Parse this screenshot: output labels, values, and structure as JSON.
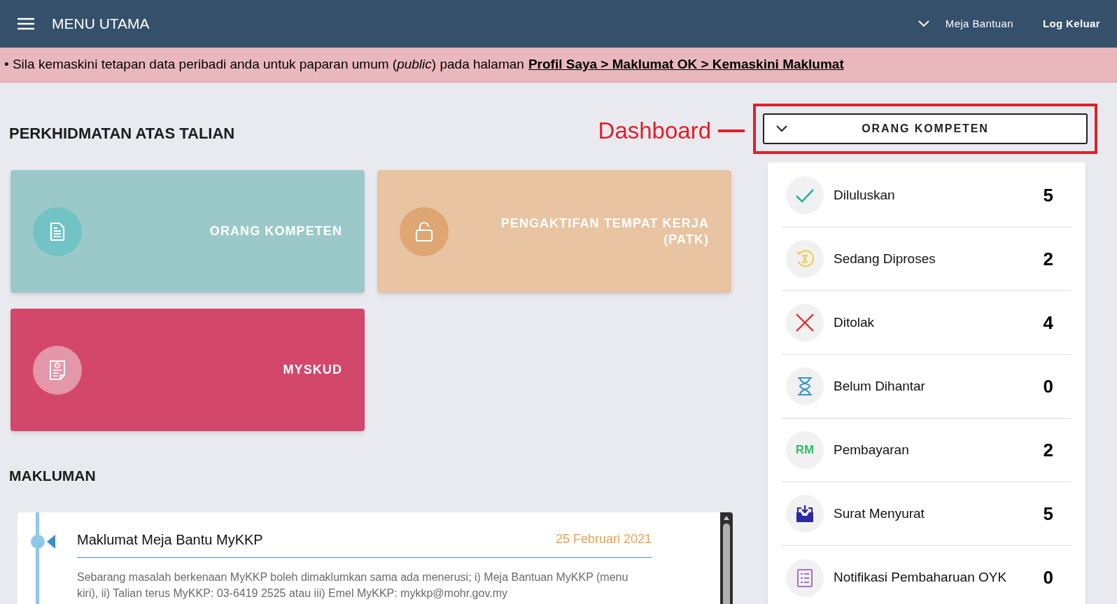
{
  "header": {
    "menu_title": "MENU UTAMA",
    "help_label": "Meja Bantuan",
    "logout_label": "Log Keluar"
  },
  "notice": {
    "text": "• Sila kemaskini tetapan data peribadi anda untuk paparan umum (*public*) pada halaman",
    "link": "Profil Saya > Maklumat OK > Kemaskini Maklumat"
  },
  "services": {
    "title": "PERKHIDMATAN ATAS TALIAN",
    "cards": [
      {
        "kind": "document",
        "label": "ORANG KOMPETEN",
        "color": "#9bc9c9"
      },
      {
        "kind": "lock",
        "label": "PENGAKTIFAN TEMPAT KERJA (PATK)",
        "color": "#e8c4a2"
      },
      {
        "kind": "report",
        "label": "MYSKUD",
        "color": "#d3476a"
      }
    ]
  },
  "dashboard": {
    "annotation": "Dashboard",
    "selected": "ORANG KOMPETEN"
  },
  "stats": [
    {
      "kind": "approved",
      "label": "Diluluskan",
      "count": "5"
    },
    {
      "kind": "processing",
      "label": "Sedang Diproses",
      "count": "2"
    },
    {
      "kind": "rejected",
      "label": "Ditolak",
      "count": "4"
    },
    {
      "kind": "pending",
      "label": "Belum Dihantar",
      "count": "0"
    },
    {
      "kind": "payment",
      "label": "Pembayaran",
      "count": "2",
      "icon_text": "RM"
    },
    {
      "kind": "mail",
      "label": "Surat Menyurat",
      "count": "5"
    },
    {
      "kind": "notification",
      "label": "Notifikasi Pembaharuan OYK",
      "count": "0"
    }
  ],
  "announcements": {
    "title": "MAKLUMAN",
    "items": [
      {
        "title": "Maklumat Meja Bantu MyKKP",
        "date": "25 Februari 2021",
        "body": "Sebarang masalah berkenaan MyKKP boleh dimaklumkan sama ada menerusi; i) Meja Bantuan MyKKP (menu kiri), ii) Talian terus MyKKP: 03-6419 2525 atau iii) Emel MyKKP: mykkp@mohr.gov.my"
      }
    ]
  }
}
